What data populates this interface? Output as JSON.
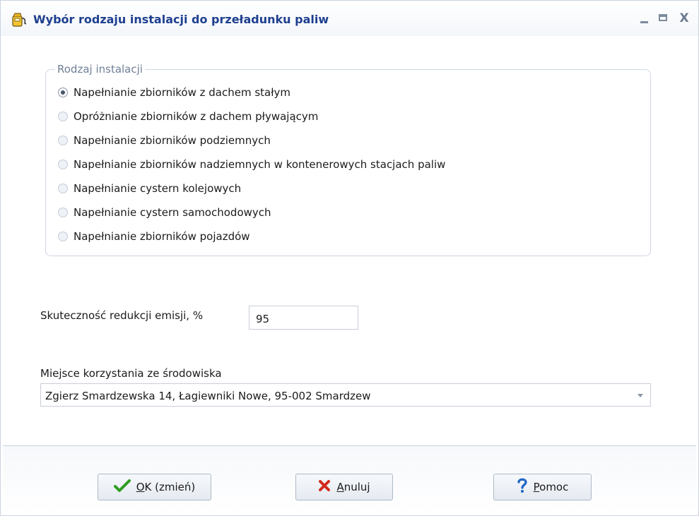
{
  "window": {
    "title": "Wybór rodzaju instalacji do przeładunku paliw"
  },
  "titlebar_buttons": {
    "close": "X"
  },
  "installation_group": {
    "legend": "Rodzaj instalacji",
    "options": [
      {
        "label": "Napełnianie zbiorników z dachem stałym",
        "checked": true
      },
      {
        "label": "Opróżnianie zbiorników z dachem pływającym",
        "checked": false
      },
      {
        "label": "Napełnianie zbiorników podziemnych",
        "checked": false
      },
      {
        "label": "Napełnianie zbiorników nadziemnych w kontenerowych stacjach paliw",
        "checked": false
      },
      {
        "label": "Napełnianie cystern kolejowych",
        "checked": false
      },
      {
        "label": "Napełnianie cystern samochodowych",
        "checked": false
      },
      {
        "label": "Napełnianie zbiorników pojazdów",
        "checked": false
      }
    ]
  },
  "efficiency": {
    "label": "Skuteczność redukcji emisji, %",
    "value": "95"
  },
  "location": {
    "label": "Miejsce korzystania ze środowiska",
    "value": "Zgierz Smardzewska 14, Łagiewniki Nowe, 95-002 Smardzew"
  },
  "buttons": {
    "ok": {
      "hotkey": "O",
      "rest": "K (zmień)"
    },
    "cancel": {
      "hotkey": "A",
      "rest": "nuluj"
    },
    "help": {
      "hotkey": "P",
      "rest": "omoc"
    }
  },
  "colors": {
    "title": "#1e3f8f",
    "ok_icon": "#2e9d1f",
    "cancel_icon": "#d22a1d",
    "help_icon": "#1d67c9"
  },
  "icons": {
    "app": "fuel-dispenser-icon",
    "ok": "checkmark-icon",
    "cancel": "x-mark-icon",
    "help": "question-mark-icon"
  }
}
